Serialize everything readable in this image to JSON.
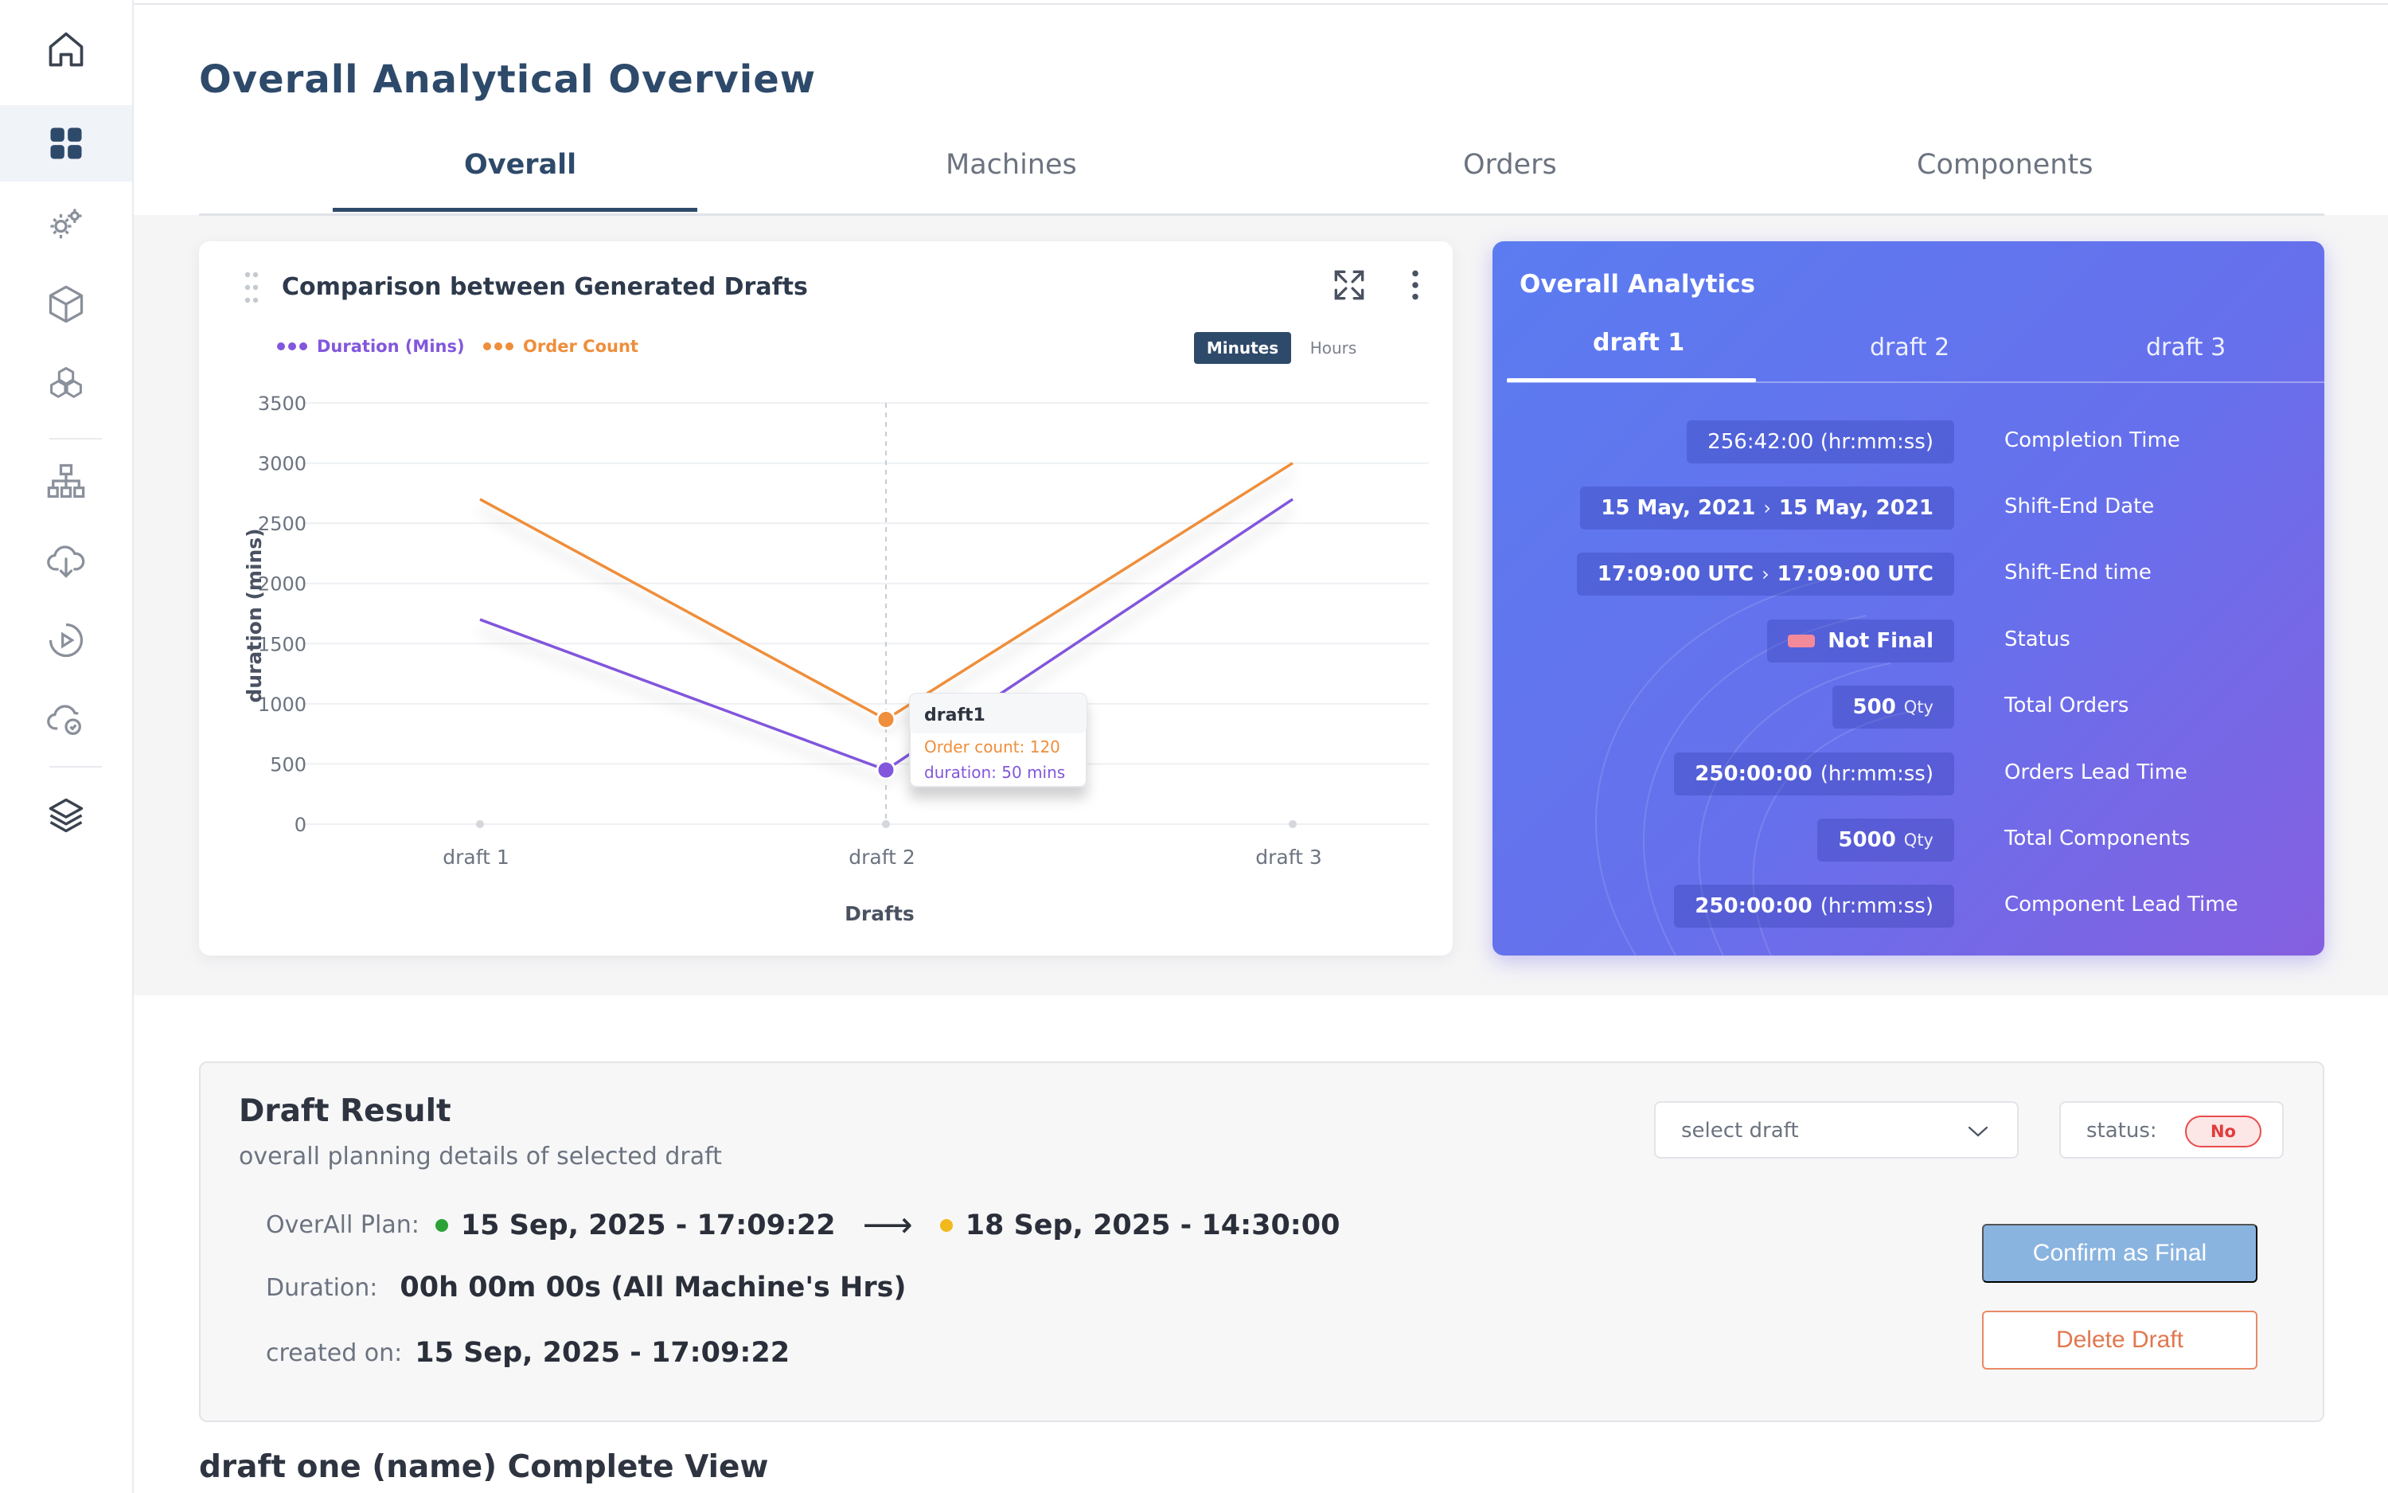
{
  "page": {
    "title": "Overall Analytical Overview"
  },
  "tabs": [
    "Overall",
    "Machines",
    "Orders",
    "Components"
  ],
  "sidebar": {
    "icons": [
      "home-icon",
      "dashboard-icon",
      "gears-icon",
      "box-icon",
      "boxes-icon",
      "hierarchy-icon",
      "cloud-download-icon",
      "play-circle-icon",
      "cloud-sync-icon",
      "layers-icon"
    ]
  },
  "comparison": {
    "title": "Comparison between Generated Drafts",
    "unit_on": "Minutes",
    "unit_off": "Hours",
    "tooltip": {
      "title": "draft1",
      "order": "Order count: 120",
      "duration": "duration: 50 mins"
    }
  },
  "chart_data": {
    "type": "line",
    "categories": [
      "draft 1",
      "draft 2",
      "draft 3"
    ],
    "series": [
      {
        "name": "Duration (Mins)",
        "values": [
          1700,
          450,
          2700
        ],
        "color": "#8257dc"
      },
      {
        "name": "Order Count",
        "values": [
          2700,
          870,
          3000
        ],
        "color": "#ef8e3b"
      }
    ],
    "xlabel": "Drafts",
    "ylabel": "duration (mins)",
    "ylim": [
      0,
      3500
    ],
    "yticks": [
      0,
      500,
      1000,
      1500,
      2000,
      2500,
      3000,
      3500
    ],
    "grid": true,
    "legend": "top-left",
    "hover_category": "draft 2"
  },
  "analytics": {
    "title": "Overall Analytics",
    "tabs": [
      "draft 1",
      "draft 2",
      "draft 3"
    ],
    "completion": {
      "value": "256:42:00 (hr:mm:ss)",
      "label": "Completion Time"
    },
    "shift_date": {
      "from": "15 May, 2021",
      "sep": "›",
      "to": "15 May, 2021",
      "label": "Shift-End Date"
    },
    "shift_time": {
      "from": "17:09:00 UTC",
      "sep": "›",
      "to": "17:09:00 UTC",
      "label": "Shift-End time"
    },
    "status": {
      "value": "Not Final",
      "label": "Status"
    },
    "orders": {
      "value": "500",
      "unit": "Qty",
      "label": "Total Orders"
    },
    "orders_lead": {
      "value": "250:00:00",
      "unit": "(hr:mm:ss)",
      "label": "Orders Lead Time"
    },
    "components": {
      "value": "5000",
      "unit": "Qty",
      "label": "Total Components"
    },
    "component_lead": {
      "value": "250:00:00",
      "unit": "(hr:mm:ss)",
      "label": "Component Lead Time"
    }
  },
  "draft_result": {
    "title": "Draft Result",
    "subtitle": "overall planning details of selected draft",
    "select_placeholder": "select draft",
    "status_label": "status:",
    "status_value": "No",
    "plan_label": "OverAll Plan:",
    "plan_start": "15 Sep, 2025 - 17:09:22",
    "plan_arrow": "⟶",
    "plan_end": "18 Sep, 2025 - 14:30:00",
    "duration_label": "Duration:",
    "duration_value": "00h 00m 00s (All Machine's Hrs)",
    "created_label": "created on:",
    "created_value": "15 Sep, 2025 - 17:09:22",
    "confirm_label": "Confirm as Final",
    "delete_label": "Delete Draft"
  },
  "complete_view": {
    "title": "draft one (name) Complete View"
  },
  "colors": {
    "primary": "#2e4a6b",
    "duration": "#8257dc",
    "order": "#ef8e3b",
    "start_dot": "#2aa236",
    "end_dot": "#f2b81c"
  }
}
